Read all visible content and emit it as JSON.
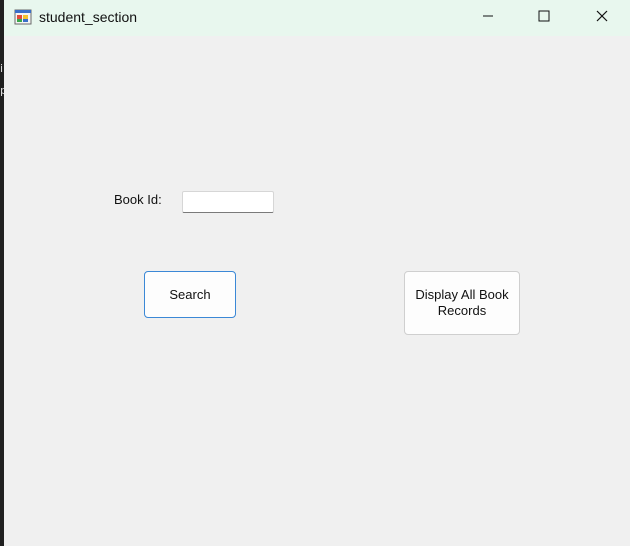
{
  "window": {
    "title": "student_section",
    "controls": {
      "minimize_icon": "minimize-icon",
      "maximize_icon": "maximize-icon",
      "close_icon": "close-icon"
    }
  },
  "form": {
    "book_id_label": "Book Id:",
    "book_id_value": "",
    "search_label": "Search",
    "display_all_label": "Display All Book Records"
  },
  "colors": {
    "titlebar": "#e8f7ee",
    "background": "#f0f0f0",
    "focus_border": "#3b88d6"
  }
}
